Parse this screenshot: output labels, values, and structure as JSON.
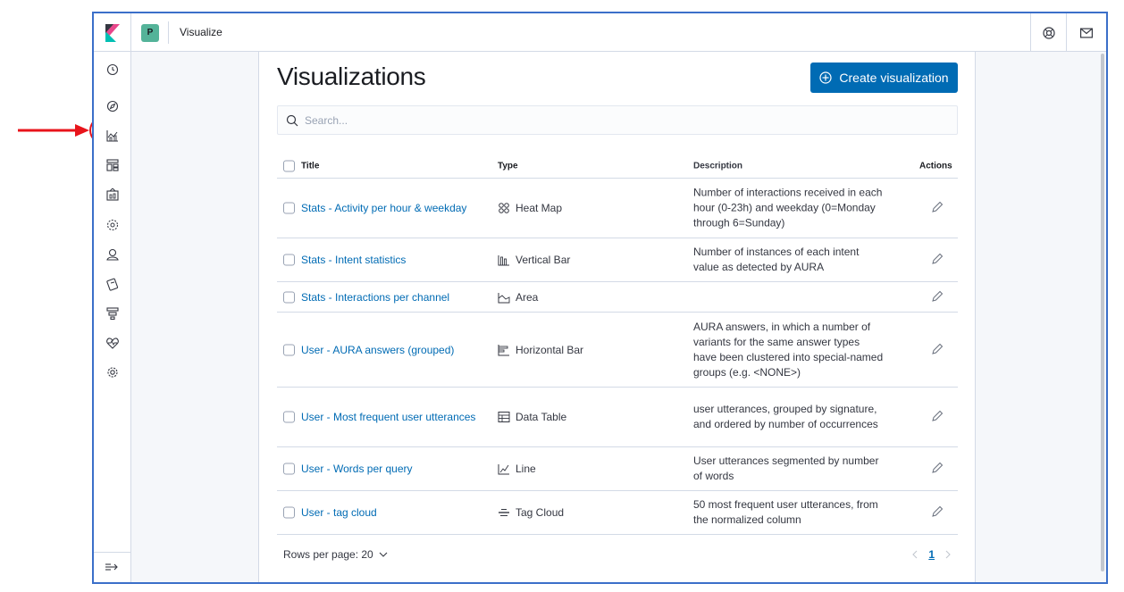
{
  "topbar": {
    "space_initial": "P",
    "app_title": "Visualize"
  },
  "sidenav": {
    "items": [
      {
        "icon": "clock-icon"
      },
      {
        "icon": "compass-icon"
      },
      {
        "icon": "visualize-icon"
      },
      {
        "icon": "dashboard-icon"
      },
      {
        "icon": "canvas-icon"
      },
      {
        "icon": "maps-icon"
      },
      {
        "icon": "user-icon"
      },
      {
        "icon": "dev-tools-icon"
      },
      {
        "icon": "stack-icon"
      },
      {
        "icon": "heartbeat-icon"
      },
      {
        "icon": "gear-icon"
      }
    ]
  },
  "page": {
    "title": "Visualizations",
    "create_button": "Create visualization",
    "search_placeholder": "Search..."
  },
  "table": {
    "headers": {
      "title": "Title",
      "type": "Type",
      "description": "Description",
      "actions": "Actions"
    },
    "rows": [
      {
        "title": "Stats - Activity per hour & weekday",
        "type": "Heat Map",
        "type_icon": "heatmap-icon",
        "description": "Number of interactions received in each hour (0-23h) and weekday (0=Monday through 6=Sunday)"
      },
      {
        "title": "Stats - Intent statistics",
        "type": "Vertical Bar",
        "type_icon": "vertical-bar-icon",
        "description": "Number of instances of each intent value as detected by AURA"
      },
      {
        "title": "Stats - Interactions per channel",
        "type": "Area",
        "type_icon": "area-icon",
        "description": ""
      },
      {
        "title": "User - AURA answers (grouped)",
        "type": "Horizontal Bar",
        "type_icon": "horizontal-bar-icon",
        "description": "AURA answers, in which a number of variants for the same answer types have been clustered into special-named groups (e.g. <NONE>)"
      },
      {
        "title": "User - Most frequent user utterances",
        "type": "Data Table",
        "type_icon": "data-table-icon",
        "description": "user utterances, grouped by signature, and ordered by number of occurrences"
      },
      {
        "title": "User - Words per query",
        "type": "Line",
        "type_icon": "line-chart-icon",
        "description": "User utterances segmented by number of words"
      },
      {
        "title": "User - tag cloud",
        "type": "Tag Cloud",
        "type_icon": "tag-cloud-icon",
        "description": "50 most frequent user utterances, from the normalized column"
      }
    ]
  },
  "pagination": {
    "rows_per_page": "Rows per page: 20",
    "current_page": "1"
  },
  "colors": {
    "accent": "#006bb4",
    "annotation": "#e8141b",
    "frame": "#3b6fc9"
  }
}
